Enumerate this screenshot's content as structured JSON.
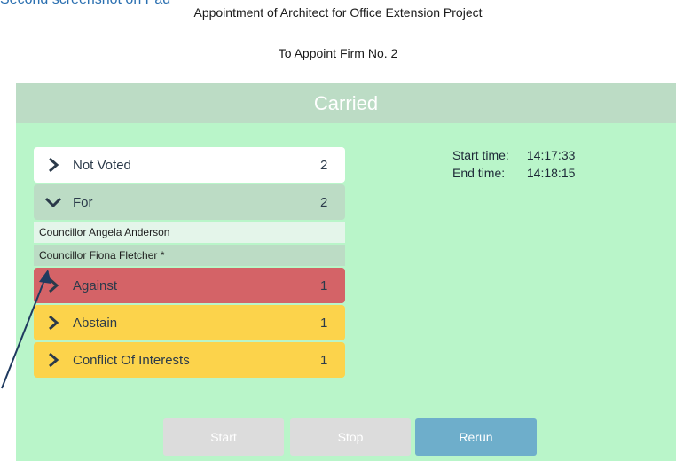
{
  "caption": "Second screenshot on Pad",
  "motion": {
    "title": "Appointment of Architect for Office Extension Project",
    "subtitle": "To Appoint Firm No. 2"
  },
  "result": "Carried",
  "vote_groups": [
    {
      "label": "Not Voted",
      "count": "2",
      "expanded": false
    },
    {
      "label": "For",
      "count": "2",
      "expanded": true,
      "members": [
        "Councillor Angela Anderson",
        "Councillor Fiona Fletcher *"
      ]
    },
    {
      "label": "Against",
      "count": "1",
      "expanded": false
    },
    {
      "label": "Abstain",
      "count": "1",
      "expanded": false
    },
    {
      "label": "Conflict Of Interests",
      "count": "1",
      "expanded": false
    }
  ],
  "times": {
    "start_label": "Start time:",
    "start_value": "14:17:33",
    "end_label": "End time:",
    "end_value": "14:18:15"
  },
  "buttons": {
    "start": "Start",
    "stop": "Stop",
    "rerun": "Rerun"
  },
  "colors": {
    "panel": "#b9f5c9",
    "for": "#bcdcc5",
    "against": "#d46367",
    "abstain": "#fcd34b",
    "rerun": "#6eaecb"
  }
}
